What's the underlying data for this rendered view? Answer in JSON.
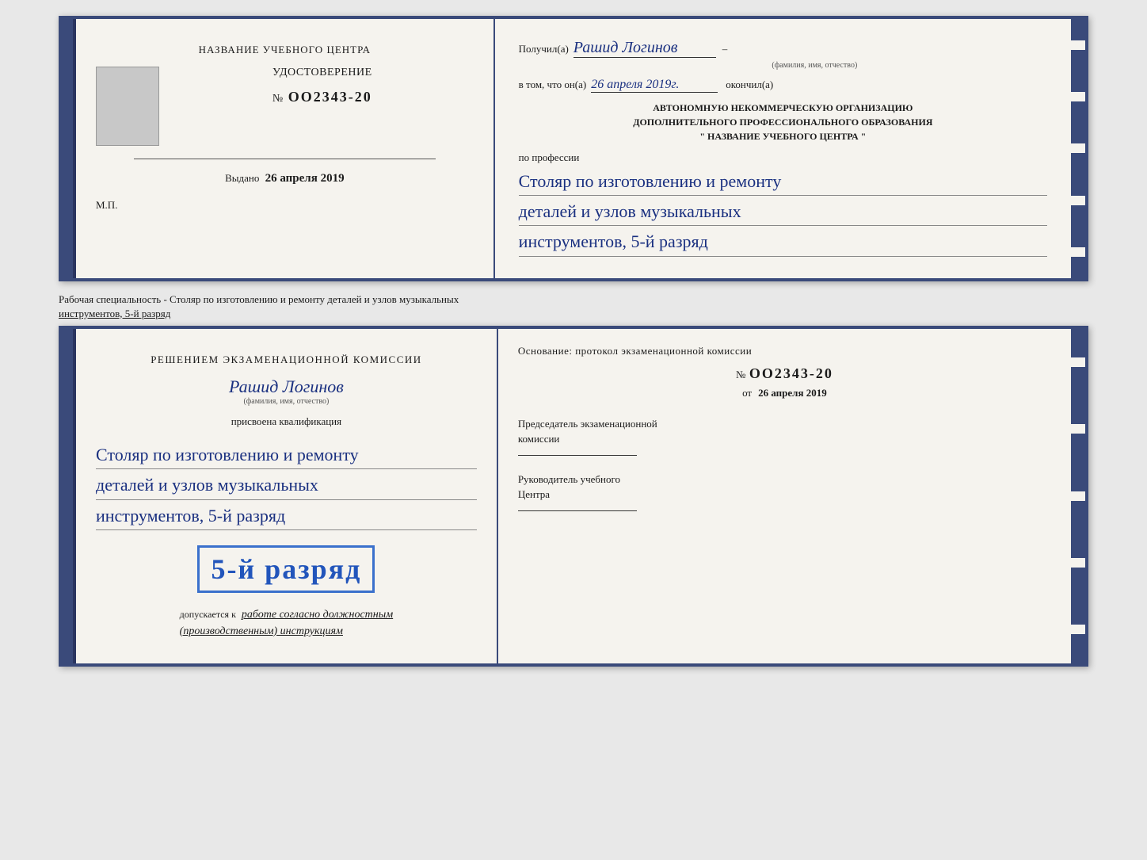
{
  "doc1": {
    "left": {
      "training_center_label": "НАЗВАНИЕ УЧЕБНОГО ЦЕНТРА",
      "cert_label": "УДОСТОВЕРЕНИЕ",
      "cert_number_prefix": "№",
      "cert_number": "OO2343-20",
      "issued_label": "Выдано",
      "issued_date": "26 апреля 2019",
      "mp_label": "М.П."
    },
    "right": {
      "received_prefix": "Получил(а)",
      "recipient_name": "Рашид Логинов",
      "fio_sub": "(фамилия, имя, отчество)",
      "dash1": "–",
      "in_that_prefix": "в том, что он(а)",
      "completion_date_hw": "26 апреля 2019г.",
      "completed_label": "окончил(а)",
      "org_line1": "АВТОНОМНУЮ НЕКОММЕРЧЕСКУЮ ОРГАНИЗАЦИЮ",
      "org_line2": "ДОПОЛНИТЕЛЬНОГО ПРОФЕССИОНАЛЬНОГО ОБРАЗОВАНИЯ",
      "org_line3": "\"   НАЗВАНИЕ УЧЕБНОГО ЦЕНТРА   \"",
      "profession_label": "по профессии",
      "profession_line1": "Столяр по изготовлению и ремонту",
      "profession_line2": "деталей и узлов музыкальных",
      "profession_line3": "инструментов, 5-й разряд"
    }
  },
  "separator": {
    "text": "Рабочая специальность - Столяр по изготовлению и ремонту деталей и узлов музыкальных",
    "text2": "инструментов, 5-й разряд"
  },
  "doc2": {
    "left": {
      "decision_label": "Решением экзаменационной комиссии",
      "recipient_name": "Рашид Логинов",
      "fio_sub": "(фамилия, имя, отчество)",
      "assigned_label": "присвоена квалификация",
      "qual_line1": "Столяр по изготовлению и ремонту",
      "qual_line2": "деталей и узлов музыкальных",
      "qual_line3": "инструментов, 5-й разряд",
      "rank_label": "5-й разряд",
      "allowed_prefix": "допускается к",
      "allowed_text": "работе согласно должностным",
      "allowed_text2": "(производственным) инструкциям"
    },
    "right": {
      "basis_label": "Основание: протокол экзаменационной комиссии",
      "protocol_prefix": "№",
      "protocol_number": "OO2343-20",
      "date_prefix": "от",
      "date_value": "26 апреля 2019",
      "chairman_line1": "Председатель экзаменационной",
      "chairman_line2": "комиссии",
      "director_line1": "Руководитель учебного",
      "director_line2": "Центра"
    }
  }
}
